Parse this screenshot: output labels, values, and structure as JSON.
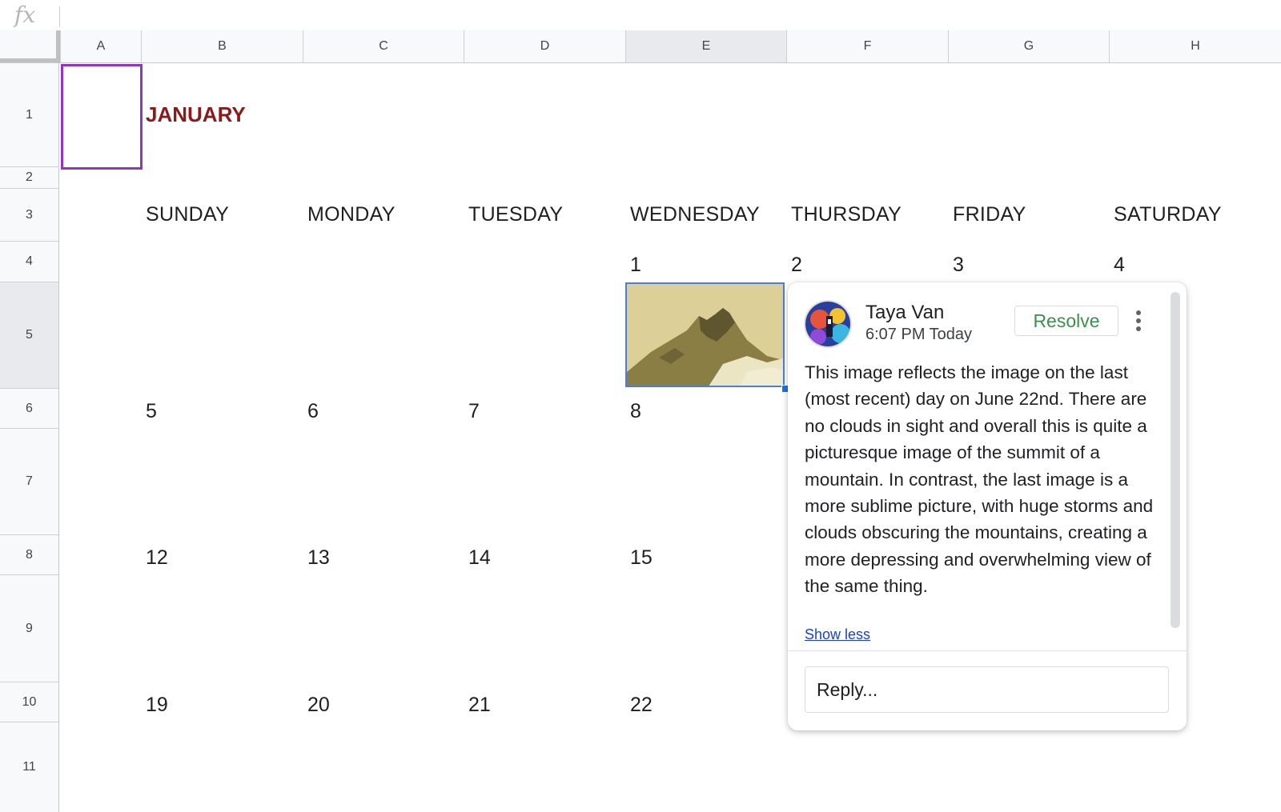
{
  "formula_bar": {
    "fx_label": "fx"
  },
  "columns": [
    "A",
    "B",
    "C",
    "D",
    "E",
    "F",
    "G",
    "H"
  ],
  "rows": [
    "1",
    "2",
    "3",
    "4",
    "5",
    "6",
    "7",
    "8",
    "9",
    "10",
    "11"
  ],
  "selected_column": "E",
  "selected_row": "5",
  "calendar": {
    "month": "JANUARY",
    "days": [
      "SUNDAY",
      "MONDAY",
      "TUESDAY",
      "WEDNESDAY",
      "THURSDAY",
      "FRIDAY",
      "SATURDAY"
    ],
    "week1": [
      "1",
      "2",
      "3",
      "4"
    ],
    "week2": [
      "5",
      "6",
      "7",
      "8"
    ],
    "week3": [
      "12",
      "13",
      "14",
      "15"
    ],
    "week4": [
      "19",
      "20",
      "21",
      "22"
    ]
  },
  "comment": {
    "author": "Taya Van",
    "time": "6:07 PM Today",
    "resolve_label": "Resolve",
    "text": "This image reflects the image on the last (most recent) day on June 22nd. There are no clouds in sight and overall this is quite a picturesque image of the summit of a mountain. In contrast, the last image is a more sublime picture, with huge storms and clouds obscuring the mountains, creating a more depressing and overwhelming view of the same thing.",
    "show_less": "Show less",
    "reply_placeholder": "Reply..."
  },
  "colors": {
    "selection": "#9334c4",
    "title": "#8b1a1a",
    "resolve": "#3c8f4c",
    "link": "#1a3fd6"
  }
}
